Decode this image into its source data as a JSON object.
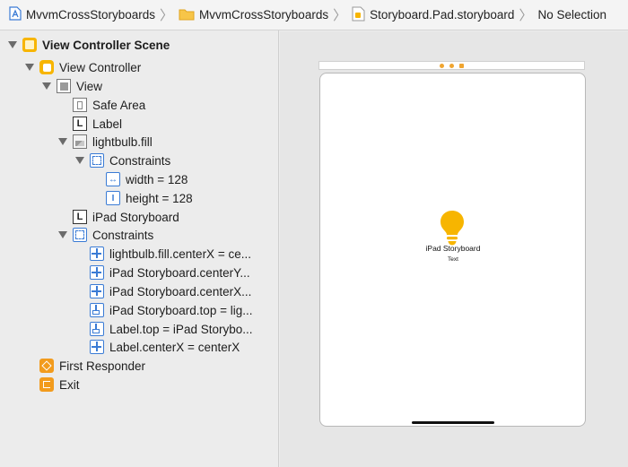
{
  "jumpbar": {
    "crumbs": [
      {
        "label": "MvvmCrossStoryboards",
        "icon": "project-icon"
      },
      {
        "label": "MvvmCrossStoryboards",
        "icon": "folder-icon"
      },
      {
        "label": "Storyboard.Pad.storyboard",
        "icon": "storyboard-file-icon"
      },
      {
        "label": "No Selection",
        "icon": ""
      }
    ]
  },
  "outline": {
    "scene": "View Controller Scene",
    "view_controller": "View Controller",
    "view": "View",
    "safe_area": "Safe Area",
    "label": "Label",
    "image_view": "lightbulb.fill",
    "image_constraints": "Constraints",
    "width_constraint": "width = 128",
    "height_constraint": "height = 128",
    "ipad_label": "iPad Storyboard",
    "view_constraints": "Constraints",
    "constraints": [
      "lightbulb.fill.centerX = ce...",
      "iPad Storyboard.centerY...",
      "iPad Storyboard.centerX...",
      "iPad Storyboard.top = lig...",
      "Label.top = iPad Storybo...",
      "Label.centerX = centerX"
    ],
    "first_responder": "First Responder",
    "exit": "Exit"
  },
  "canvas": {
    "title_text": "iPad Storyboard",
    "subtitle_text": "Text",
    "bulb_color": "#f7b500",
    "accent_color": "#3a7bd5",
    "scene_icon_color": "#f7b500"
  }
}
